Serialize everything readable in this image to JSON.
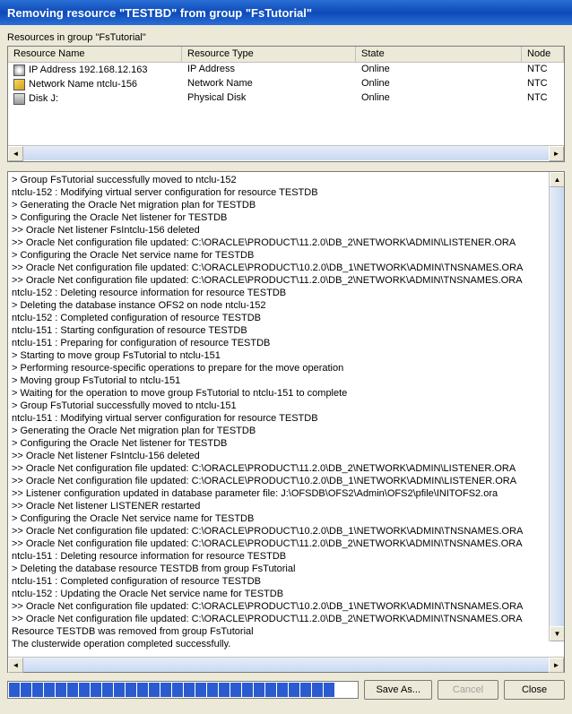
{
  "titlebar": "Removing resource \"TESTBD\" from group \"FsTutorial\"",
  "group_label": "Resources in group \"FsTutorial\"",
  "table": {
    "headers": {
      "name": "Resource Name",
      "type": "Resource Type",
      "state": "State",
      "node": "Node"
    },
    "rows": [
      {
        "name": "IP Address 192.168.12.163",
        "type": "IP Address",
        "state": "Online",
        "node": "NTC"
      },
      {
        "name": "Network Name ntclu-156",
        "type": "Network Name",
        "state": "Online",
        "node": "NTC"
      },
      {
        "name": "Disk J:",
        "type": "Physical Disk",
        "state": "Online",
        "node": "NTC"
      }
    ]
  },
  "log": [
    " > Group FsTutorial successfully moved to ntclu-152",
    "ntclu-152 : Modifying virtual server configuration for resource TESTDB",
    " > Generating the Oracle Net migration plan for TESTDB",
    " > Configuring the Oracle Net listener for TESTDB",
    " >> Oracle Net listener FsIntclu-156 deleted",
    " >> Oracle Net configuration file updated: C:\\ORACLE\\PRODUCT\\11.2.0\\DB_2\\NETWORK\\ADMIN\\LISTENER.ORA",
    " > Configuring the Oracle Net service name for TESTDB",
    " >> Oracle Net configuration file updated: C:\\ORACLE\\PRODUCT\\10.2.0\\DB_1\\NETWORK\\ADMIN\\TNSNAMES.ORA",
    " >> Oracle Net configuration file updated: C:\\ORACLE\\PRODUCT\\11.2.0\\DB_2\\NETWORK\\ADMIN\\TNSNAMES.ORA",
    "ntclu-152 : Deleting resource information for resource TESTDB",
    " > Deleting the database instance OFS2 on node ntclu-152",
    "ntclu-152 : Completed configuration of resource TESTDB",
    "ntclu-151 : Starting configuration of resource TESTDB",
    "ntclu-151 : Preparing for configuration of resource TESTDB",
    " > Starting to move group FsTutorial to ntclu-151",
    " > Performing resource-specific operations to prepare for the move operation",
    " > Moving group FsTutorial to ntclu-151",
    " > Waiting for the operation to move group FsTutorial to ntclu-151 to complete",
    " > Group FsTutorial successfully moved to ntclu-151",
    "ntclu-151 : Modifying virtual server configuration for resource TESTDB",
    " > Generating the Oracle Net migration plan for TESTDB",
    " > Configuring the Oracle Net listener for TESTDB",
    " >> Oracle Net listener FsIntclu-156 deleted",
    " >> Oracle Net configuration file updated: C:\\ORACLE\\PRODUCT\\11.2.0\\DB_2\\NETWORK\\ADMIN\\LISTENER.ORA",
    " >> Oracle Net configuration file updated: C:\\ORACLE\\PRODUCT\\10.2.0\\DB_1\\NETWORK\\ADMIN\\LISTENER.ORA",
    " >> Listener configuration updated in database parameter file: J:\\OFSDB\\OFS2\\Admin\\OFS2\\pfile\\INITOFS2.ora",
    " >> Oracle Net listener LISTENER restarted",
    " > Configuring the Oracle Net service name for TESTDB",
    " >> Oracle Net configuration file updated: C:\\ORACLE\\PRODUCT\\10.2.0\\DB_1\\NETWORK\\ADMIN\\TNSNAMES.ORA",
    " >> Oracle Net configuration file updated: C:\\ORACLE\\PRODUCT\\11.2.0\\DB_2\\NETWORK\\ADMIN\\TNSNAMES.ORA",
    "ntclu-151 : Deleting resource information for resource TESTDB",
    " > Deleting the database resource TESTDB from group FsTutorial",
    "ntclu-151 : Completed configuration of resource TESTDB",
    "ntclu-152 : Updating the Oracle Net service name for TESTDB",
    " >> Oracle Net configuration file updated: C:\\ORACLE\\PRODUCT\\10.2.0\\DB_1\\NETWORK\\ADMIN\\TNSNAMES.ORA",
    " >> Oracle Net configuration file updated: C:\\ORACLE\\PRODUCT\\11.2.0\\DB_2\\NETWORK\\ADMIN\\TNSNAMES.ORA",
    "Resource  TESTDB   was removed from group FsTutorial",
    "The clusterwide operation completed successfully."
  ],
  "buttons": {
    "save_as": "Save As...",
    "cancel": "Cancel",
    "close": "Close"
  }
}
